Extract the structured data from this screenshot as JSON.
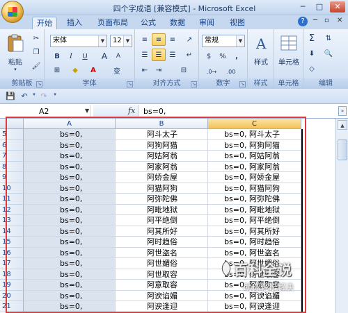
{
  "titlebar": {
    "title": "四个字成语  [兼容模式] - Microsoft Excel",
    "minimize": "─",
    "maximize": "□",
    "close": "✕"
  },
  "quick_access": {
    "save_icon": "save-icon",
    "undo_icon": "undo-icon",
    "redo_icon": "redo-icon"
  },
  "tabs": [
    "开始",
    "插入",
    "页面布局",
    "公式",
    "数据",
    "审阅",
    "视图"
  ],
  "active_tab": "开始",
  "ribbon": {
    "clipboard": {
      "label": "剪贴板",
      "paste": "粘贴"
    },
    "font": {
      "label": "字体",
      "name": "宋体",
      "size": "12",
      "bold": "B",
      "italic": "I",
      "underline": "U",
      "grow": "A",
      "shrink": "A",
      "wen": "变"
    },
    "alignment": {
      "label": "对齐方式"
    },
    "number": {
      "label": "数字",
      "format": "常规",
      "percent": "%",
      "comma": ",",
      "currency": "$"
    },
    "styles": {
      "label": "样式",
      "style_btn": "样式"
    },
    "cells": {
      "label": "单元格",
      "cells_btn": "单元格"
    },
    "editing": {
      "label": "编辑",
      "sum": "Σ"
    }
  },
  "formula_bar": {
    "name_box": "A2",
    "fx": "fx",
    "formula": "bs=0,"
  },
  "columns": [
    "A",
    "B",
    "C"
  ],
  "active_column": "C",
  "rows": [
    {
      "num": "5",
      "a": "bs=0,",
      "b": "阿斗太子",
      "c": "bs=0, 阿斗太子"
    },
    {
      "num": "6",
      "a": "bs=0,",
      "b": "阿狗阿猫",
      "c": "bs=0, 阿狗阿猫"
    },
    {
      "num": "7",
      "a": "bs=0,",
      "b": "阿姑阿翁",
      "c": "bs=0, 阿姑阿翁"
    },
    {
      "num": "8",
      "a": "bs=0,",
      "b": "阿家阿翁",
      "c": "bs=0, 阿家阿翁"
    },
    {
      "num": "9",
      "a": "bs=0,",
      "b": "阿娇金屋",
      "c": "bs=0, 阿娇金屋"
    },
    {
      "num": "10",
      "a": "bs=0,",
      "b": "阿猫阿狗",
      "c": "bs=0, 阿猫阿狗"
    },
    {
      "num": "11",
      "a": "bs=0,",
      "b": "阿弥陀佛",
      "c": "bs=0, 阿弥陀佛"
    },
    {
      "num": "12",
      "a": "bs=0,",
      "b": "阿毗地狱",
      "c": "bs=0, 阿毗地狱"
    },
    {
      "num": "13",
      "a": "bs=0,",
      "b": "阿平绝倒",
      "c": "bs=0, 阿平绝倒"
    },
    {
      "num": "14",
      "a": "bs=0,",
      "b": "阿其所好",
      "c": "bs=0, 阿其所好"
    },
    {
      "num": "15",
      "a": "bs=0,",
      "b": "阿时趋俗",
      "c": "bs=0, 阿时趋俗"
    },
    {
      "num": "16",
      "a": "bs=0,",
      "b": "阿世盗名",
      "c": "bs=0, 阿世盗名"
    },
    {
      "num": "17",
      "a": "bs=0,",
      "b": "阿世媚俗",
      "c": "bs=0, 阿世媚俗"
    },
    {
      "num": "18",
      "a": "bs=0,",
      "b": "阿世取容",
      "c": "bs=0, 阿世取容"
    },
    {
      "num": "19",
      "a": "bs=0,",
      "b": "阿意取容",
      "c": "bs=0, 阿意取容"
    },
    {
      "num": "20",
      "a": "bs=0,",
      "b": "阿谀谄媚",
      "c": "bs=0, 阿谀谄媚"
    },
    {
      "num": "21",
      "a": "bs=0,",
      "b": "阿谀逢迎",
      "c": "bs=0, 阿谀逢迎"
    }
  ],
  "watermark": {
    "title": "百科全说",
    "subtitle": "助你轻松解决"
  }
}
